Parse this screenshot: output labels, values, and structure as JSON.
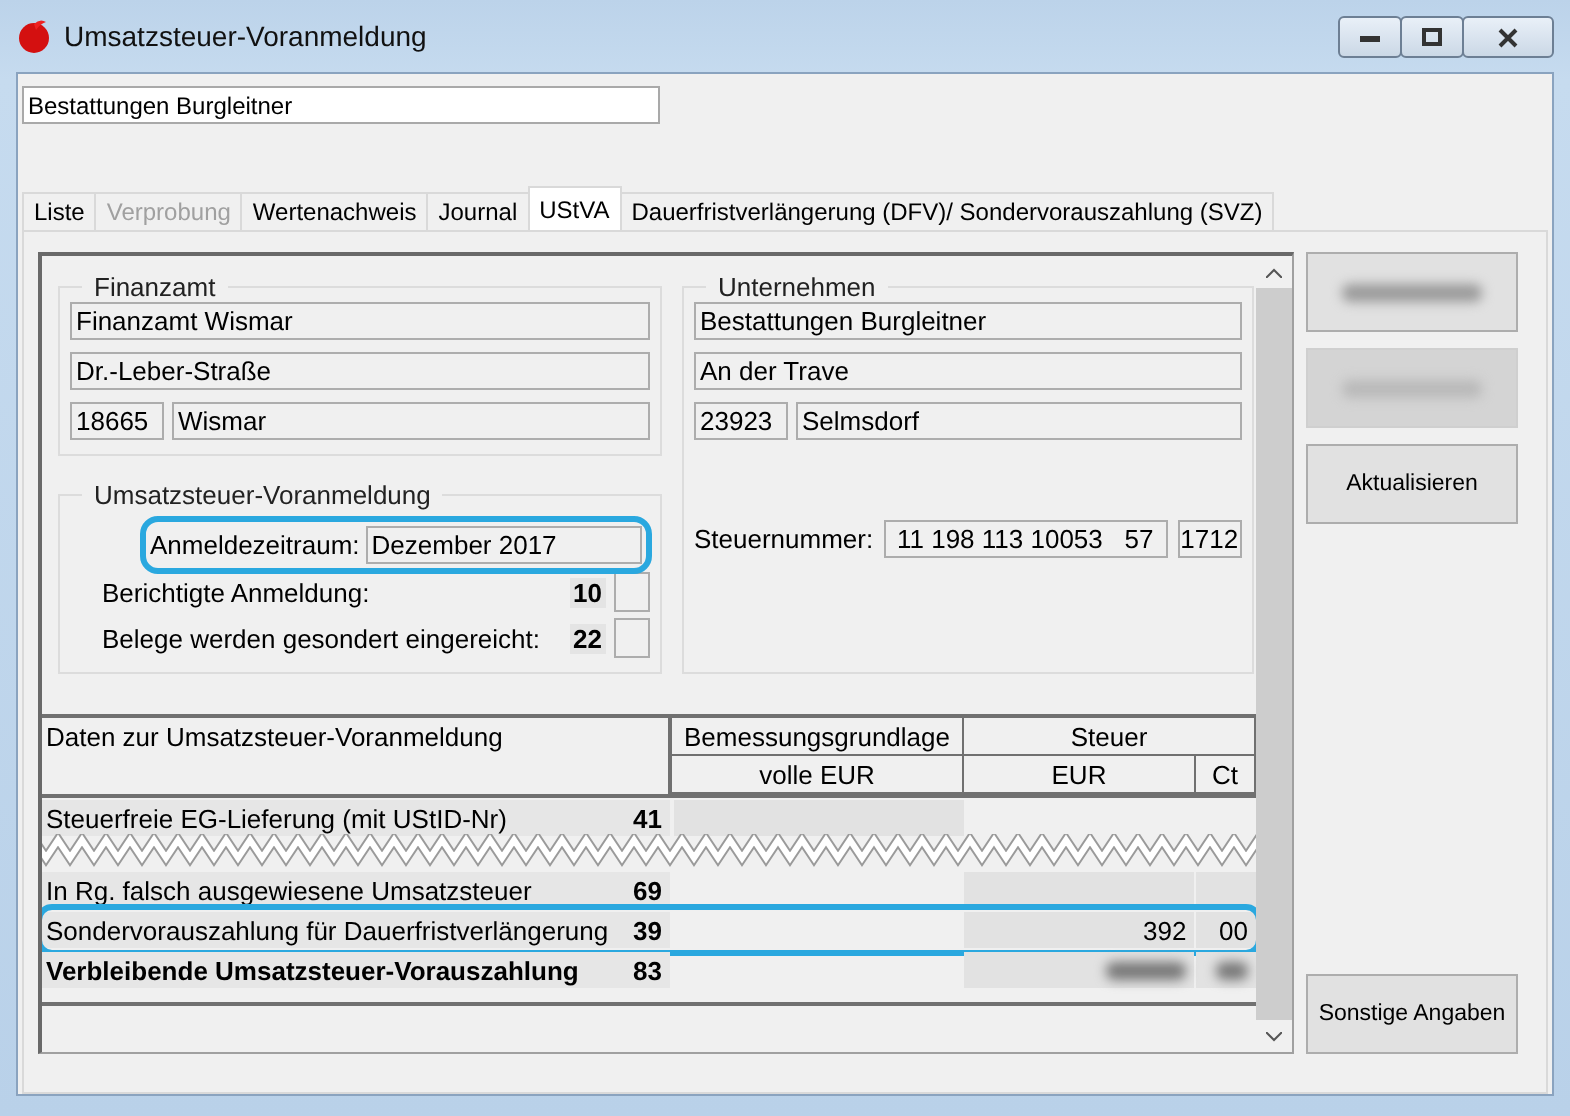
{
  "window": {
    "title": "Umsatzsteuer-Voranmeldung"
  },
  "company_field": {
    "value": "Bestattungen Burgleitner"
  },
  "tabs": [
    {
      "label": "Liste",
      "selected": false,
      "disabled": false
    },
    {
      "label": "Verprobung",
      "selected": false,
      "disabled": true
    },
    {
      "label": "Wertenachweis",
      "selected": false,
      "disabled": false
    },
    {
      "label": "Journal",
      "selected": false,
      "disabled": false
    },
    {
      "label": "UStVA",
      "selected": true,
      "disabled": false
    },
    {
      "label": "Dauerfristverlängerung (DFV)/ Sondervorauszahlung (SVZ)",
      "selected": false,
      "disabled": false
    }
  ],
  "finanzamt": {
    "title": "Finanzamt",
    "name": "Finanzamt Wismar",
    "street": "Dr.-Leber-Straße",
    "zip": "18665",
    "city": "Wismar"
  },
  "unternehmen": {
    "title": "Unternehmen",
    "name": "Bestattungen Burgleitner",
    "street": "An der Trave",
    "zip": "23923",
    "city": "Selmsdorf",
    "tax_number_label": "Steuernummer:",
    "tax_number": "11 198 113 10053   57",
    "tax_number_suffix": "1712"
  },
  "voranmeldung": {
    "title": "Umsatzsteuer-Voranmeldung",
    "period_label": "Anmeldezeitraum:",
    "period": "Dezember 2017",
    "highlighted": true,
    "options": [
      {
        "label": "Berichtigte Anmeldung:",
        "code": "10",
        "checked": false
      },
      {
        "label": "Belege werden gesondert eingereicht:",
        "code": "22",
        "checked": false
      }
    ]
  },
  "table": {
    "title": "Daten zur Umsatzsteuer-Voranmeldung",
    "base_header": "Bemessungsgrundlage",
    "base_unit": "volle EUR",
    "tax_header": "Steuer",
    "tax_eur": "EUR",
    "tax_ct": "Ct",
    "rows": [
      {
        "kind": "row",
        "label": "Steuerfreie EG-Lieferung (mit UStID-Nr)",
        "code": "41",
        "bold": false,
        "highlighted": false,
        "base_shaded": true,
        "tax_shaded": false,
        "blurred": false
      },
      {
        "kind": "torn"
      },
      {
        "kind": "row",
        "label": "In Rg. falsch ausgewiesene Umsatzsteuer",
        "code": "69",
        "bold": false,
        "highlighted": false,
        "base_shaded": false,
        "tax_shaded": true,
        "blurred": false
      },
      {
        "kind": "row",
        "label": "Sondervorauszahlung für Dauerfristverlängerung",
        "code": "39",
        "bold": false,
        "highlighted": true,
        "base_shaded": false,
        "tax_shaded": true,
        "blurred": false,
        "eur": "392",
        "ct": "00"
      },
      {
        "kind": "row",
        "label": "Verbleibende Umsatzsteuer-Vorauszahlung",
        "code": "83",
        "bold": true,
        "highlighted": false,
        "base_shaded": false,
        "tax_shaded": true,
        "blurred": true
      },
      {
        "kind": "cut"
      }
    ]
  },
  "buttons": [
    {
      "kind": "blurred",
      "disabled": false
    },
    {
      "kind": "blurred",
      "disabled": true
    },
    {
      "kind": "text",
      "label": "Aktualisieren",
      "disabled": false
    },
    {
      "kind": "spacer"
    },
    {
      "kind": "text",
      "label": "Sonstige Angaben",
      "disabled": false
    }
  ]
}
